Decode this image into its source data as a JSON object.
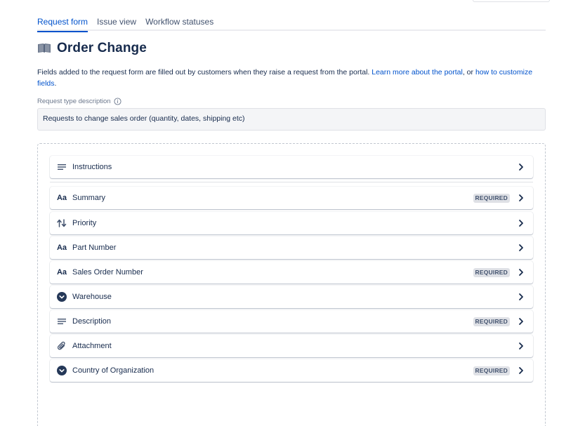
{
  "tabs": [
    {
      "label": "Request form",
      "active": true
    },
    {
      "label": "Issue view",
      "active": false
    },
    {
      "label": "Workflow statuses",
      "active": false
    }
  ],
  "header": {
    "icon": "book-icon",
    "title": "Order Change"
  },
  "intro": {
    "text_before": "Fields added to the request form are filled out by customers when they raise a request from the portal. ",
    "link1": "Learn more about the portal",
    "text_between": ", or ",
    "link2": "how to customize fields",
    "text_after": "."
  },
  "description": {
    "label": "Request type description",
    "value": "Requests to change sales order (quantity, dates, shipping etc)"
  },
  "fields": [
    {
      "label": "Instructions",
      "icon": "lines-icon",
      "required": false
    },
    {
      "label": "Summary",
      "icon": "text-icon",
      "required": true
    },
    {
      "label": "Priority",
      "icon": "priority-arrows-icon",
      "required": false
    },
    {
      "label": "Part Number",
      "icon": "text-icon",
      "required": false
    },
    {
      "label": "Sales Order Number",
      "icon": "text-icon",
      "required": true
    },
    {
      "label": "Warehouse",
      "icon": "dropdown-circle-icon",
      "required": false
    },
    {
      "label": "Description",
      "icon": "lines-icon",
      "required": true
    },
    {
      "label": "Attachment",
      "icon": "paperclip-icon",
      "required": false
    },
    {
      "label": "Country of Organization",
      "icon": "dropdown-circle-icon",
      "required": true
    }
  ],
  "required_badge": "REQUIRED",
  "text_icon_glyph": "Aa",
  "colors": {
    "link": "#0052cc",
    "text": "#172b4d",
    "badge_bg": "#dfe1e6"
  }
}
